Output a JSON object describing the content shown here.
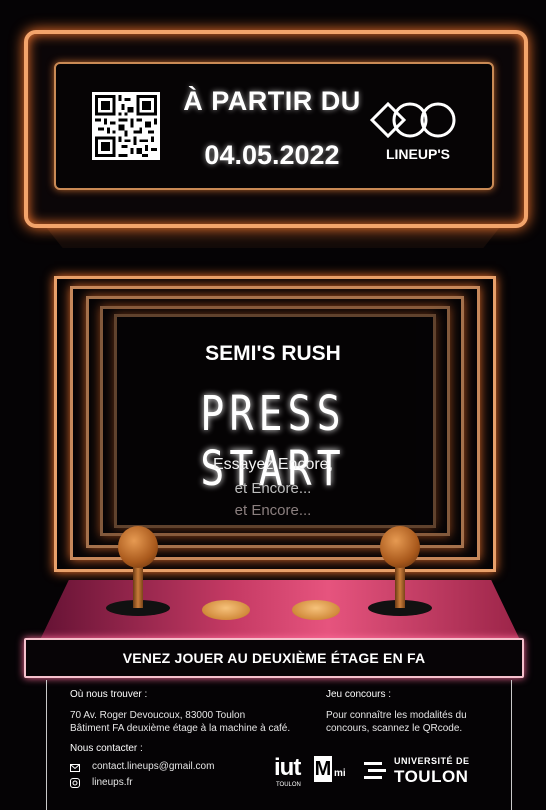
{
  "marquee": {
    "headline": "À PARTIR DU",
    "date": "04.05.2022",
    "brand": "LINEUP'S"
  },
  "screen": {
    "game_title": "SEMI'S RUSH",
    "prompt": "PRESS START",
    "lines": [
      "Essayez Encore,",
      "et Encore...",
      "et Encore..."
    ]
  },
  "banner": "VENEZ JOUER AU DEUXIÈME ÉTAGE EN FA",
  "info": {
    "where_title": "Où nous trouver :",
    "address": "70 Av. Roger Devoucoux, 83000 Toulon",
    "building": "Bâtiment FA deuxième étage à la machine à café.",
    "contact_title": "Nous contacter :",
    "email": "contact.lineups@gmail.com",
    "website": "lineups.fr",
    "contest_title": "Jeu concours :",
    "contest_text_1": "Pour connaître les modalités du",
    "contest_text_2": "concours, scannez le QRcode."
  },
  "logos": {
    "iut": "iut",
    "iut_sub": "TOULON",
    "mmi": "mi",
    "univ_top": "UNIVERSITÉ DE",
    "univ_bottom": "TOULON"
  },
  "colors": {
    "neon_orange": "#f3a46b",
    "neon_pink": "#f5c1cc",
    "panel_pink": "#e6547e"
  }
}
